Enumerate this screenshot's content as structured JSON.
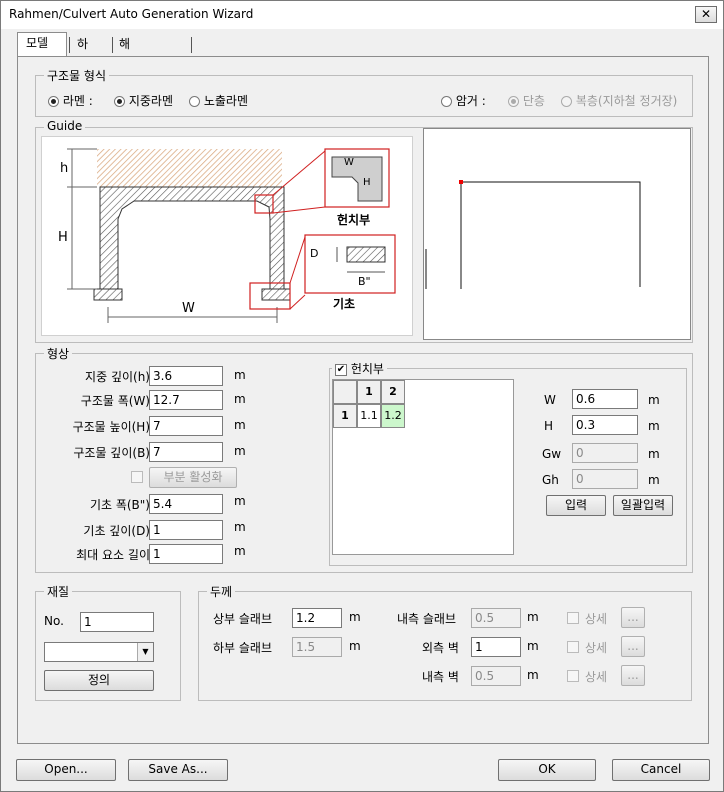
{
  "window": {
    "title": "Rahmen/Culvert Auto Generation Wizard",
    "close_glyph": "✕"
  },
  "tabs": [
    {
      "label": "모델"
    },
    {
      "label": "하중"
    },
    {
      "label": "해석/보고서"
    }
  ],
  "structure_type": {
    "label": "구조물 형식",
    "rahmen_label": "라멘 :",
    "buried_rahmen_label": "지중라멘",
    "exposed_rahmen_label": "노출라멘",
    "culvert_label": "암거 :",
    "single_label": "단층",
    "double_label": "복층(지하철 정거장)"
  },
  "guide": {
    "label": "Guide",
    "dim_h": "h",
    "dim_H": "H",
    "dim_W": "W",
    "haunch_w": "W",
    "haunch_h": "H",
    "haunch_caption": "헌치부",
    "foot_D": "D",
    "foot_B": "B\"",
    "foot_caption": "기초"
  },
  "shape": {
    "label": "형상",
    "fields": [
      {
        "label": "지중 깊이(h)",
        "value": "3.6",
        "unit": "m"
      },
      {
        "label": "구조물 폭(W)",
        "value": "12.7",
        "unit": "m"
      },
      {
        "label": "구조물 높이(H)",
        "value": "7",
        "unit": "m"
      },
      {
        "label": "구조물 깊이(B)",
        "value": "7",
        "unit": "m"
      }
    ],
    "partial_activation": "부분 활성화",
    "footing_fields": [
      {
        "label": "기초 폭(B\")",
        "value": "5.4",
        "unit": "m"
      },
      {
        "label": "기초 깊이(D)",
        "value": "1",
        "unit": "m"
      },
      {
        "label": "최대 요소 길이",
        "value": "1",
        "unit": "m"
      }
    ]
  },
  "haunch": {
    "label": "헌치부",
    "check": "✔",
    "grid": {
      "col1": "1",
      "col2": "2",
      "row1": "1",
      "c11": "1.1",
      "c12": "1.2"
    },
    "W_label": "W",
    "W_value": "0.6",
    "W_unit": "m",
    "H_label": "H",
    "H_value": "0.3",
    "H_unit": "m",
    "Gw_label": "Gw",
    "Gw_value": "0",
    "Gw_unit": "m",
    "Gh_label": "Gh",
    "Gh_value": "0",
    "Gh_unit": "m",
    "input_button": "입력",
    "batch_input_button": "일괄입력"
  },
  "material": {
    "label": "재질",
    "no_label": "No.",
    "no_value": "1",
    "combo_value": "",
    "combo_arrow": "▼",
    "define_button": "정의"
  },
  "thickness": {
    "label": "두께",
    "top_slab_label": "상부 슬래브",
    "top_slab_value": "1.2",
    "top_slab_unit": "m",
    "bottom_slab_label": "하부 슬래브",
    "bottom_slab_value": "1.5",
    "bottom_slab_unit": "m",
    "inner_slab_label": "내측 슬래브",
    "inner_slab_value": "0.5",
    "inner_slab_unit": "m",
    "outer_wall_label": "외측 벽",
    "outer_wall_value": "1",
    "outer_wall_unit": "m",
    "inner_wall_label": "내측 벽",
    "inner_wall_value": "0.5",
    "inner_wall_unit": "m",
    "detail_label": "상세",
    "more_button": "..."
  },
  "footer": {
    "open_button": "Open...",
    "save_as_button": "Save As...",
    "ok_button": "OK",
    "cancel_button": "Cancel"
  }
}
